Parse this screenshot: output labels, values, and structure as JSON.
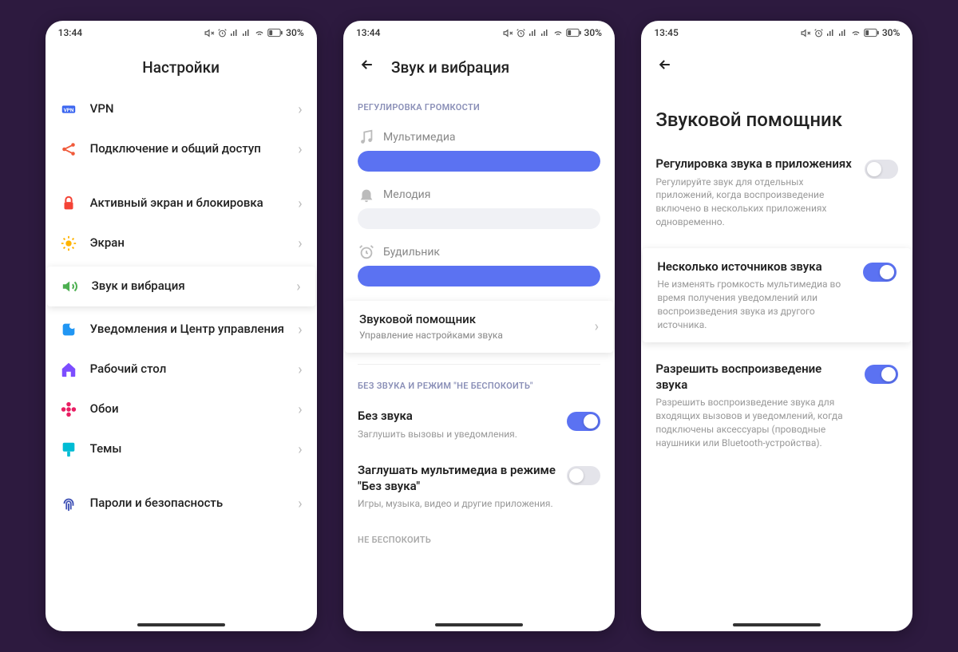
{
  "status": {
    "battery_pct": "30%"
  },
  "screen1": {
    "time": "13:44",
    "title": "Настройки",
    "items": [
      {
        "label": "VPN",
        "color": "#3a65f0",
        "icon": "vpn"
      },
      {
        "label": "Подключение и общий доступ",
        "color": "#f05a3a",
        "icon": "share"
      }
    ],
    "group2": [
      {
        "label": "Активный экран и блокировка",
        "color": "#f44336",
        "icon": "lock"
      },
      {
        "label": "Экран",
        "color": "#ffb300",
        "icon": "sun"
      },
      {
        "label": "Звук и вибрация",
        "color": "#4caf50",
        "icon": "sound",
        "highlight": true
      },
      {
        "label": "Уведомления и Центр управления",
        "color": "#2196f3",
        "icon": "notif"
      },
      {
        "label": "Рабочий стол",
        "color": "#7c4dff",
        "icon": "home"
      },
      {
        "label": "Обои",
        "color": "#e91e63",
        "icon": "flower"
      },
      {
        "label": "Темы",
        "color": "#00bcd4",
        "icon": "brush"
      }
    ],
    "group3": [
      {
        "label": "Пароли и безопасность",
        "color": "#3f51b5",
        "icon": "fingerprint"
      }
    ]
  },
  "screen2": {
    "time": "13:44",
    "title": "Звук и вибрация",
    "section1_label": "РЕГУЛИРОВКА ГРОМКОСТИ",
    "volumes": [
      {
        "label": "Мультимедиа",
        "icon": "music",
        "level": 100
      },
      {
        "label": "Мелодия",
        "icon": "bell",
        "level": 0
      },
      {
        "label": "Будильник",
        "icon": "alarm",
        "level": 100
      }
    ],
    "assistant": {
      "title": "Звуковой помощник",
      "sub": "Управление настройками звука"
    },
    "section2_label": "БЕЗ ЗВУКА И РЕЖИМ \"НЕ БЕСПОКОИТЬ\"",
    "toggles": [
      {
        "title": "Без звука",
        "desc": "Заглушить вызовы и уведомления.",
        "on": true
      },
      {
        "title": "Заглушать мультимедиа в режиме \"Без звука\"",
        "desc": "Игры, музыка, видео и другие приложения.",
        "on": false
      }
    ],
    "section3_label": "НЕ БЕСПОКОИТЬ"
  },
  "screen3": {
    "time": "13:45",
    "title": "Звуковой помощник",
    "toggles": [
      {
        "title": "Регулировка звука в приложениях",
        "desc": "Регулируйте звук для отдельных приложений, когда воспроизведение включено в нескольких приложениях одновременно.",
        "on": false,
        "highlight": false
      },
      {
        "title": "Несколько источников звука",
        "desc": "Не изменять громкость мультимедиа во время получения уведомлений или воспроизведения звука из другого источника.",
        "on": true,
        "highlight": true
      },
      {
        "title": "Разрешить воспроизведение звука",
        "desc": "Разрешить воспроизведение звука для входящих вызовов и уведомлений, когда подключены аксессуары (проводные наушники или Bluetooth-устройства).",
        "on": true,
        "highlight": false
      }
    ]
  }
}
